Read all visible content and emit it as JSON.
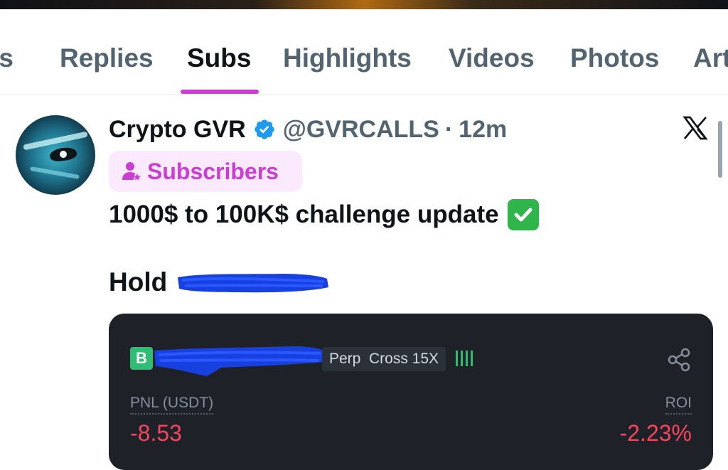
{
  "tabs": [
    {
      "label": "ts"
    },
    {
      "label": "Replies"
    },
    {
      "label": "Subs",
      "active": true
    },
    {
      "label": "Highlights"
    },
    {
      "label": "Videos"
    },
    {
      "label": "Photos"
    },
    {
      "label": "Art"
    }
  ],
  "tweet": {
    "author_name": "Crypto GVR",
    "handle": "@GVRCALLS",
    "separator": "·",
    "time": "12m",
    "badge_label": "Subscribers",
    "line1": "1000$ to 100K$ challenge update",
    "line2_prefix": "Hold",
    "verified_icon": "verified-badge-icon",
    "x_logo_icon": "x-logo-icon"
  },
  "card": {
    "side_badge": "B",
    "perp_label": "Perp",
    "margin_label": "Cross 15X",
    "pnl_label": "PNL (USDT)",
    "pnl_value": "-8.53",
    "roi_label": "ROI",
    "roi_value": "-2.23%",
    "share_icon": "share-icon"
  },
  "colors": {
    "accent_tab": "#c93fd4",
    "negative": "#f6465d",
    "verified": "#1d9bf0",
    "card_bg": "#1e2228"
  }
}
